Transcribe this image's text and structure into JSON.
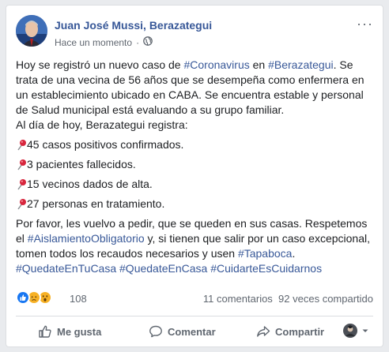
{
  "post": {
    "author": "Juan José Mussi, Berazategui",
    "timestamp": "Hace un momento",
    "separator": "·",
    "privacy_icon": "globe-icon",
    "more_label": "···",
    "paragraph1": {
      "t1": "Hoy se registró un nuevo caso de ",
      "tag1": "#Coronavirus",
      "t2": " en ",
      "tag2": "#Berazategui",
      "t3": ". Se trata de una vecina de 56 años que se desempeña como enfermera en un establecimiento ubicado en CABA. Se encuentra estable y personal de Salud municipal está evaluando a su grupo familiar."
    },
    "line2": "Al día de hoy, Berazategui registra:",
    "stats": [
      "45 casos positivos confirmados.",
      "3 pacientes fallecidos.",
      "15 vecinos dados de alta.",
      "27 personas en tratamiento."
    ],
    "paragraph3": {
      "t1": "Por favor, les vuelvo a pedir, que se queden en sus casas. Respetemos el ",
      "tag1": "#AislamientoObligatorio",
      "t2": " y, si tienen que salir por un caso excepcional, tomen todos los recaudos necesarios y usen ",
      "tag2": "#Tapaboca",
      "t3": "."
    },
    "hashtags": [
      "#QuedateEnTuCasa",
      "#QuedateEnCasa",
      "#CuidarteEsCuidarnos"
    ]
  },
  "reactions": {
    "icons": [
      "like-reaction-icon",
      "sad-reaction-icon",
      "wow-reaction-icon"
    ],
    "count": "108",
    "comments": "11 comentarios",
    "shares": "92 veces compartido"
  },
  "actions": {
    "like": "Me gusta",
    "comment": "Comentar",
    "share": "Compartir"
  },
  "colors": {
    "link": "#385898",
    "like": "#1877f2",
    "reaction_yellow": "#f7b125",
    "pin_red": "#d7263d"
  }
}
